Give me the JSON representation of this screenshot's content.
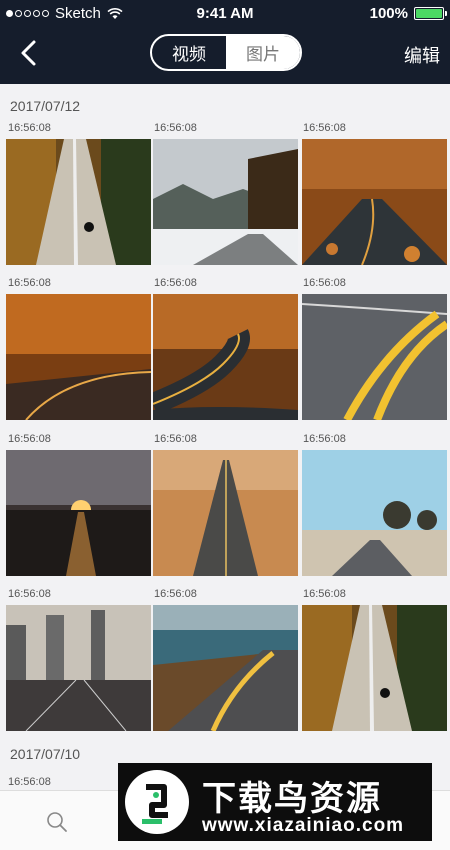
{
  "status_bar": {
    "carrier": "Sketch",
    "time": "9:41 AM",
    "battery": "100%",
    "signal_dots_filled": 1,
    "signal_dots_total": 5
  },
  "header": {
    "tabs": [
      {
        "label": "视频",
        "active": true
      },
      {
        "label": "图片",
        "active": false
      }
    ],
    "edit_label": "编辑",
    "background_color": "#151d2c"
  },
  "sections": [
    {
      "date": "2017/07/12",
      "photos": [
        {
          "time": "16:56:08",
          "scene": "forest-road-biker"
        },
        {
          "time": "16:56:08",
          "scene": "snowy-mountain-road"
        },
        {
          "time": "16:56:08",
          "scene": "autumn-leaf-road"
        },
        {
          "time": "16:56:08",
          "scene": "autumn-wet-road"
        },
        {
          "time": "16:56:08",
          "scene": "winding-autumn-road"
        },
        {
          "time": "16:56:08",
          "scene": "yellow-lines-asphalt"
        },
        {
          "time": "16:56:08",
          "scene": "sunset-road"
        },
        {
          "time": "16:56:08",
          "scene": "desert-straight-road"
        },
        {
          "time": "16:56:08",
          "scene": "joshua-tree-road"
        },
        {
          "time": "16:56:08",
          "scene": "city-highway"
        },
        {
          "time": "16:56:08",
          "scene": "coastal-road"
        },
        {
          "time": "16:56:08",
          "scene": "forest-road-biker-2"
        }
      ]
    },
    {
      "date": "2017/07/10",
      "photos": [
        {
          "time": "16:56:08",
          "scene": "partial"
        }
      ]
    }
  ],
  "tabbar": {
    "icon": "search-icon"
  },
  "watermark": {
    "title": "下载鸟资源",
    "url": "www.xiazainiao.com"
  }
}
